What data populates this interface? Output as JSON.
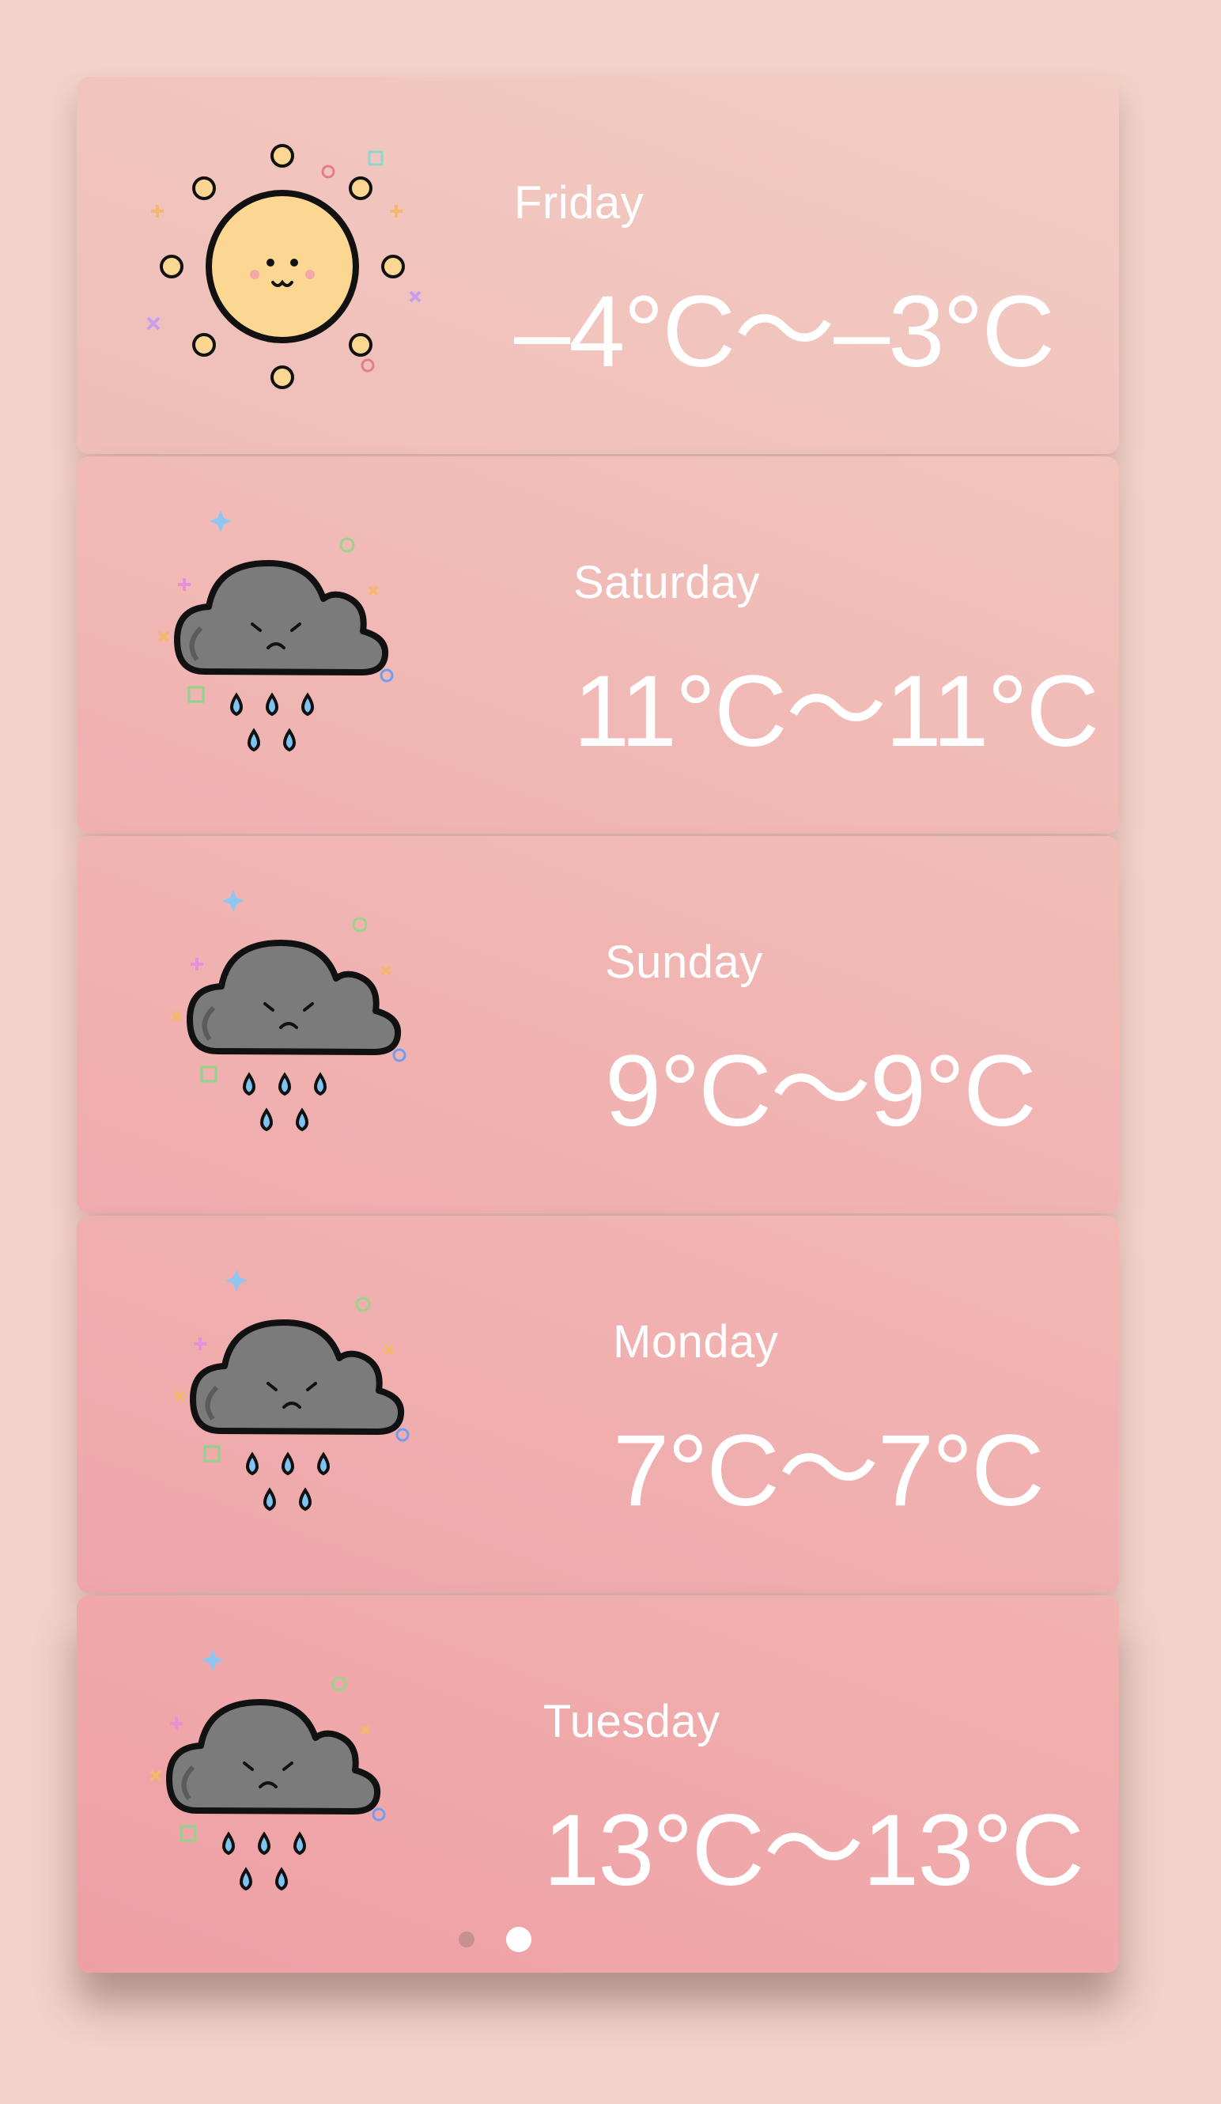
{
  "forecast": [
    {
      "day": "Friday",
      "range": "–4°C～–3°C",
      "icon": "sun-icon"
    },
    {
      "day": "Saturday",
      "range": "11°C～11°C",
      "icon": "rain-cloud-icon"
    },
    {
      "day": "Sunday",
      "range": "9°C～9°C",
      "icon": "rain-cloud-icon"
    },
    {
      "day": "Monday",
      "range": "7°C～7°C",
      "icon": "rain-cloud-icon"
    },
    {
      "day": "Tuesday",
      "range": "13°C～13°C",
      "icon": "rain-cloud-icon"
    }
  ],
  "pager": {
    "pages": 2,
    "current": 2
  },
  "colors": {
    "background": "#f2d2c8",
    "text": "#ffffff",
    "sun": "#fcd792",
    "cloud": "#7b7b7b",
    "rain": "#7fc3f0"
  }
}
